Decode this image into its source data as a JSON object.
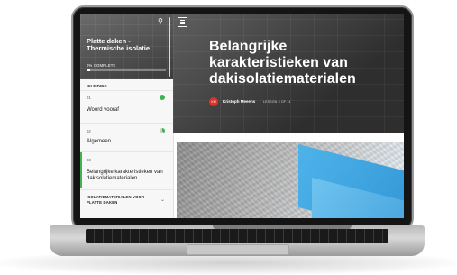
{
  "sidebar": {
    "course_title": "Platte daken - Thermische isolatie",
    "progress_label": "0% COMPLETE",
    "progress_value": 0.05,
    "section_header": "INLEIDING",
    "items": [
      {
        "number": "01",
        "label": "Woord vooraf",
        "status": "complete"
      },
      {
        "number": "02",
        "label": "Algemeen",
        "status": "in-progress"
      },
      {
        "number": "03",
        "label": "Belangrijke karakteristieken van dakisolatiematerialen",
        "status": "active"
      }
    ],
    "next_section_header": "ISOLATIEMATERIALEN VOOR PLATTE DAKEN"
  },
  "main": {
    "lesson_title": "Belangrijke karakteristieken van dakisolatiematerialen",
    "author_initials": "KM",
    "author_name": "Kristoph Meeens",
    "lesson_count": "LESSON 3 OF 14"
  },
  "colors": {
    "accent_green": "#3fb34f",
    "avatar_red": "#d9342b",
    "insulation_blue": "#2b8fd1"
  },
  "icons": {
    "search": "search-icon",
    "menu": "menu-icon"
  }
}
